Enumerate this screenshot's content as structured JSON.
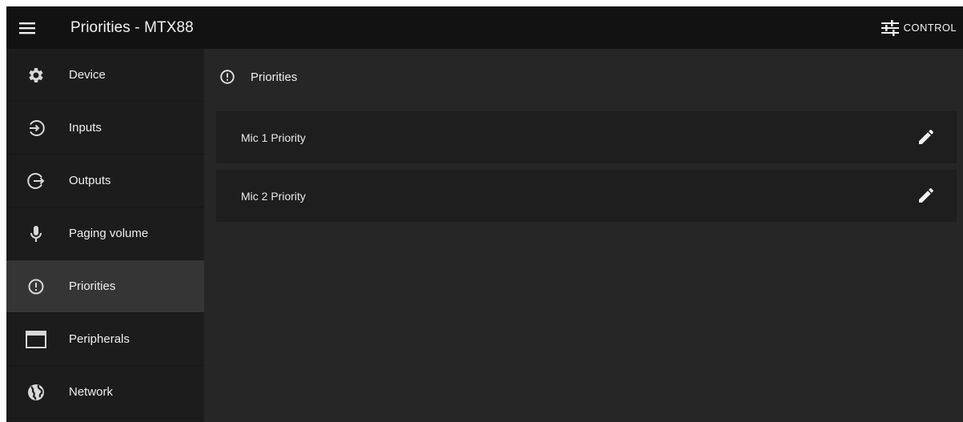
{
  "header": {
    "title": "Priorities - MTX88",
    "menu_icon": "hamburger-menu-icon",
    "control": {
      "label": "CONTROL",
      "icon": "sliders-icon"
    }
  },
  "sidebar": {
    "items": [
      {
        "label": "Device",
        "icon": "gear-icon",
        "active": false
      },
      {
        "label": "Inputs",
        "icon": "input-arrow-icon",
        "active": false
      },
      {
        "label": "Outputs",
        "icon": "output-arrow-icon",
        "active": false
      },
      {
        "label": "Paging volume",
        "icon": "microphone-icon",
        "active": false
      },
      {
        "label": "Priorities",
        "icon": "priority-alert-icon",
        "active": true
      },
      {
        "label": "Peripherals",
        "icon": "window-icon",
        "active": false
      },
      {
        "label": "Network",
        "icon": "globe-icon",
        "active": false
      }
    ]
  },
  "main": {
    "section": {
      "title": "Priorities",
      "icon": "priority-alert-icon"
    },
    "rows": [
      {
        "label": "Mic 1 Priority",
        "action_icon": "pencil-edit-icon"
      },
      {
        "label": "Mic 2 Priority",
        "action_icon": "pencil-edit-icon"
      }
    ]
  },
  "colors": {
    "header_bg": "#121212",
    "sidebar_bg": "#1c1c1c",
    "sidebar_active_bg": "#353535",
    "content_bg": "#262626",
    "row_bg": "#1e1e1e",
    "text": "#efefef"
  }
}
